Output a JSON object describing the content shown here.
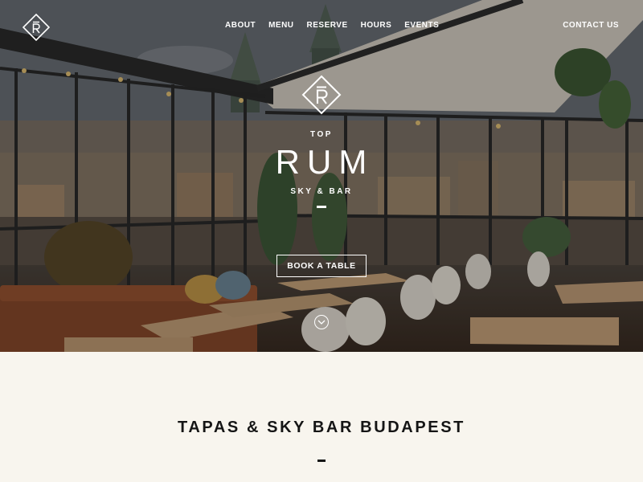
{
  "nav": {
    "logo_icon": "rum-diamond-logo-icon",
    "links": [
      {
        "label": "ABOUT"
      },
      {
        "label": "MENU"
      },
      {
        "label": "RESERVE"
      },
      {
        "label": "HOURS"
      },
      {
        "label": "EVENTS"
      }
    ],
    "contact_label": "CONTACT US"
  },
  "hero": {
    "brand_icon": "rum-diamond-logo-icon",
    "brand_top": "TOP",
    "brand_name": "RUM",
    "brand_sub": "SKY & BAR",
    "cta_label": "BOOK A TABLE",
    "scroll_icon": "chevron-down-icon"
  },
  "section": {
    "title": "TAPAS & SKY BAR BUDAPEST"
  },
  "colors": {
    "text_light": "#ffffff",
    "background_cream": "#f8f5ee",
    "text_dark": "#151515",
    "wood": "#c7a27a",
    "sofa": "#8a4a2c"
  }
}
